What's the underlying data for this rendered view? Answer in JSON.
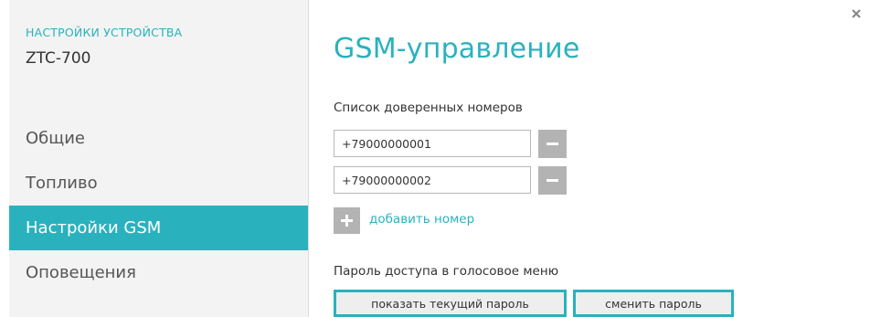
{
  "sidebar": {
    "subtitle": "НАСТРОЙКИ УСТРОЙСТВА",
    "device_name": "ZTC-700",
    "items": [
      {
        "label": "Общие"
      },
      {
        "label": "Топливо"
      },
      {
        "label": "Настройки GSM"
      },
      {
        "label": "Оповещения"
      }
    ],
    "active_index": 2
  },
  "close_icon": "close-icon",
  "main": {
    "title": "GSM-управление",
    "trusted_numbers_label": "Список доверенных номеров",
    "phones": [
      {
        "value": "+79000000001"
      },
      {
        "value": "+79000000002"
      }
    ],
    "remove_icon": "minus-icon",
    "add_icon": "plus-icon",
    "add_number_label": "добавить номер",
    "password_label": "Пароль доступа в голосовое меню",
    "show_password_label": "показать текущий пароль",
    "change_password_label": "сменить пароль"
  },
  "colors": {
    "accent": "#29b2bd",
    "sidebar_bg": "#f3f3f3",
    "button_gray": "#b3b3b3"
  }
}
